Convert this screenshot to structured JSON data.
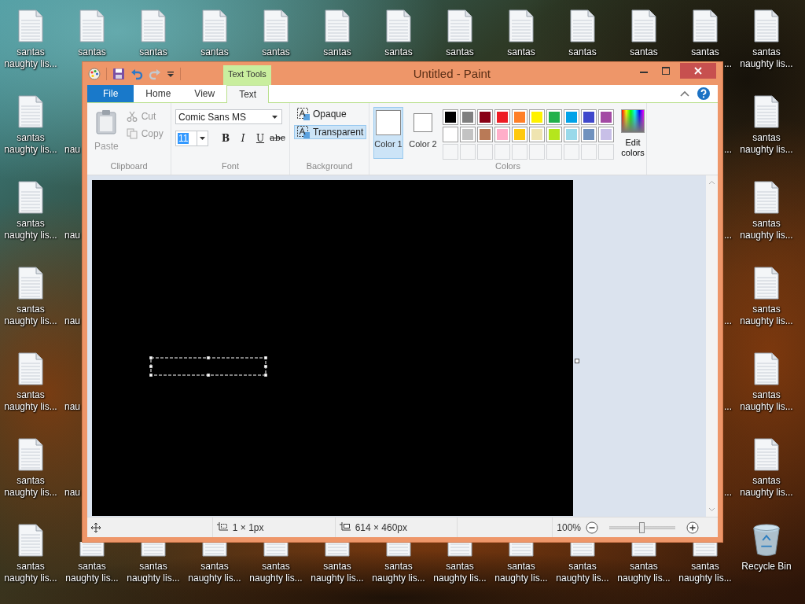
{
  "desktop_icons": [
    {
      "kind": "file",
      "lines": [
        "santas",
        "naughty lis..."
      ]
    },
    {
      "kind": "file",
      "lines": [
        "santas"
      ]
    },
    {
      "kind": "file",
      "lines": [
        "santas"
      ]
    },
    {
      "kind": "file",
      "lines": [
        "santas"
      ]
    },
    {
      "kind": "file",
      "lines": [
        "santas"
      ]
    },
    {
      "kind": "file",
      "lines": [
        "santas"
      ]
    },
    {
      "kind": "file",
      "lines": [
        "santas"
      ]
    },
    {
      "kind": "file",
      "lines": [
        "santas"
      ]
    },
    {
      "kind": "file",
      "lines": [
        "santas"
      ]
    },
    {
      "kind": "file",
      "lines": [
        "santas"
      ]
    },
    {
      "kind": "file",
      "lines": [
        "santas"
      ]
    },
    {
      "kind": "file",
      "lines": [
        "santas"
      ]
    },
    {
      "kind": "peek",
      "lines": [
        "..."
      ]
    },
    {
      "kind": "file",
      "lines": [
        "santas",
        "naughty lis..."
      ]
    },
    {
      "kind": "file",
      "lines": [
        "santas",
        "naughty lis..."
      ]
    },
    {
      "kind": "peek",
      "lines": [
        "nau"
      ]
    },
    {
      "kind": "peek",
      "lines": [
        "..."
      ]
    },
    {
      "kind": "file",
      "lines": [
        "santas",
        "naughty lis..."
      ]
    },
    {
      "kind": "file",
      "lines": [
        "santas",
        "naughty lis..."
      ]
    },
    {
      "kind": "peek",
      "lines": [
        "nau"
      ]
    },
    {
      "kind": "peek",
      "lines": [
        "..."
      ]
    },
    {
      "kind": "file",
      "lines": [
        "santas",
        "naughty lis..."
      ]
    },
    {
      "kind": "file",
      "lines": [
        "santas",
        "naughty lis..."
      ]
    },
    {
      "kind": "peek",
      "lines": [
        "nau"
      ]
    },
    {
      "kind": "peek",
      "lines": [
        "..."
      ]
    },
    {
      "kind": "file",
      "lines": [
        "santas",
        "naughty lis..."
      ]
    },
    {
      "kind": "file",
      "lines": [
        "santas",
        "naughty lis..."
      ]
    },
    {
      "kind": "peek",
      "lines": [
        "nau"
      ]
    },
    {
      "kind": "peek",
      "lines": [
        "..."
      ]
    },
    {
      "kind": "file",
      "lines": [
        "santas",
        "naughty lis..."
      ]
    },
    {
      "kind": "file",
      "lines": [
        "santas",
        "naughty lis..."
      ]
    },
    {
      "kind": "peek",
      "lines": [
        "nau"
      ]
    },
    {
      "kind": "peek",
      "lines": [
        "..."
      ]
    },
    {
      "kind": "file",
      "lines": [
        "santas",
        "naughty lis..."
      ]
    },
    {
      "kind": "file",
      "lines": [
        "santas",
        "naughty lis..."
      ]
    },
    {
      "kind": "file",
      "lines": [
        "santas",
        "naughty lis..."
      ]
    },
    {
      "kind": "file",
      "lines": [
        "santas",
        "naughty lis..."
      ]
    },
    {
      "kind": "file",
      "lines": [
        "santas",
        "naughty lis..."
      ]
    },
    {
      "kind": "file",
      "lines": [
        "santas",
        "naughty lis..."
      ]
    },
    {
      "kind": "file",
      "lines": [
        "santas",
        "naughty lis..."
      ]
    },
    {
      "kind": "file",
      "lines": [
        "santas",
        "naughty lis..."
      ]
    },
    {
      "kind": "file",
      "lines": [
        "santas",
        "naughty lis..."
      ]
    },
    {
      "kind": "file",
      "lines": [
        "santas",
        "naughty lis..."
      ]
    },
    {
      "kind": "file",
      "lines": [
        "santas",
        "naughty lis..."
      ]
    },
    {
      "kind": "file",
      "lines": [
        "santas",
        "naughty lis..."
      ]
    },
    {
      "kind": "file",
      "lines": [
        "santas",
        "naughty lis..."
      ]
    },
    {
      "kind": "recycle",
      "lines": [
        "Recycle Bin"
      ]
    }
  ],
  "window": {
    "title": "Untitled - Paint",
    "contextual_tab": "Text Tools",
    "quick_access": [
      {
        "kind": "save",
        "disabled": false
      },
      {
        "kind": "undo",
        "disabled": false
      },
      {
        "kind": "redo",
        "disabled": true
      }
    ]
  },
  "tabs": [
    {
      "label": "File",
      "kind": "file",
      "selected": false
    },
    {
      "label": "Home",
      "kind": "tab",
      "selected": false
    },
    {
      "label": "View",
      "kind": "tab",
      "selected": false
    },
    {
      "label": "Text",
      "kind": "tab",
      "selected": true
    }
  ],
  "ribbon": {
    "clipboard": {
      "label": "Clipboard",
      "paste": {
        "label": "Paste",
        "disabled": true
      },
      "cut": {
        "label": "Cut",
        "disabled": true
      },
      "copy": {
        "label": "Copy",
        "disabled": true
      }
    },
    "font": {
      "label": "Font",
      "family": "Comic Sans MS",
      "size": "11",
      "size_highlighted": true,
      "styles": [
        {
          "kind": "bold",
          "label": "B",
          "on": false
        },
        {
          "kind": "italic",
          "label": "I",
          "on": false
        },
        {
          "kind": "underline",
          "label": "U",
          "on": false
        },
        {
          "kind": "strikethrough",
          "label": "abc",
          "on": false
        }
      ]
    },
    "background": {
      "label": "Background",
      "options": [
        {
          "label": "Opaque",
          "selected": false
        },
        {
          "label": "Transparent",
          "selected": true
        }
      ]
    },
    "colors": {
      "label": "Colors",
      "edit": "Edit colors",
      "slots": [
        {
          "label": "Color 1",
          "color": "#ffffff",
          "selected": true
        },
        {
          "label": "Color 2",
          "color": "#ffffff",
          "selected": false
        }
      ],
      "palette": [
        [
          {
            "color": "#000000"
          },
          {
            "color": "#7f7f7f"
          },
          {
            "color": "#880015"
          },
          {
            "color": "#ed1c24"
          },
          {
            "color": "#ff7f27"
          },
          {
            "color": "#fff200"
          },
          {
            "color": "#22b14c"
          },
          {
            "color": "#00a2e8"
          },
          {
            "color": "#3f48cc"
          },
          {
            "color": "#a349a4"
          }
        ],
        [
          {
            "color": "#ffffff"
          },
          {
            "color": "#c3c3c3"
          },
          {
            "color": "#b97a57"
          },
          {
            "color": "#ffaec9"
          },
          {
            "color": "#ffc90e"
          },
          {
            "color": "#efe4b0"
          },
          {
            "color": "#b5e61d"
          },
          {
            "color": "#99d9ea"
          },
          {
            "color": "#7092be"
          },
          {
            "color": "#c8bfe7"
          }
        ]
      ]
    }
  },
  "status_bar": {
    "selection": "1 × 1px",
    "canvas_size": "614 × 460px",
    "zoom": "100%",
    "zoom_slider": {
      "level": 0.5
    }
  }
}
